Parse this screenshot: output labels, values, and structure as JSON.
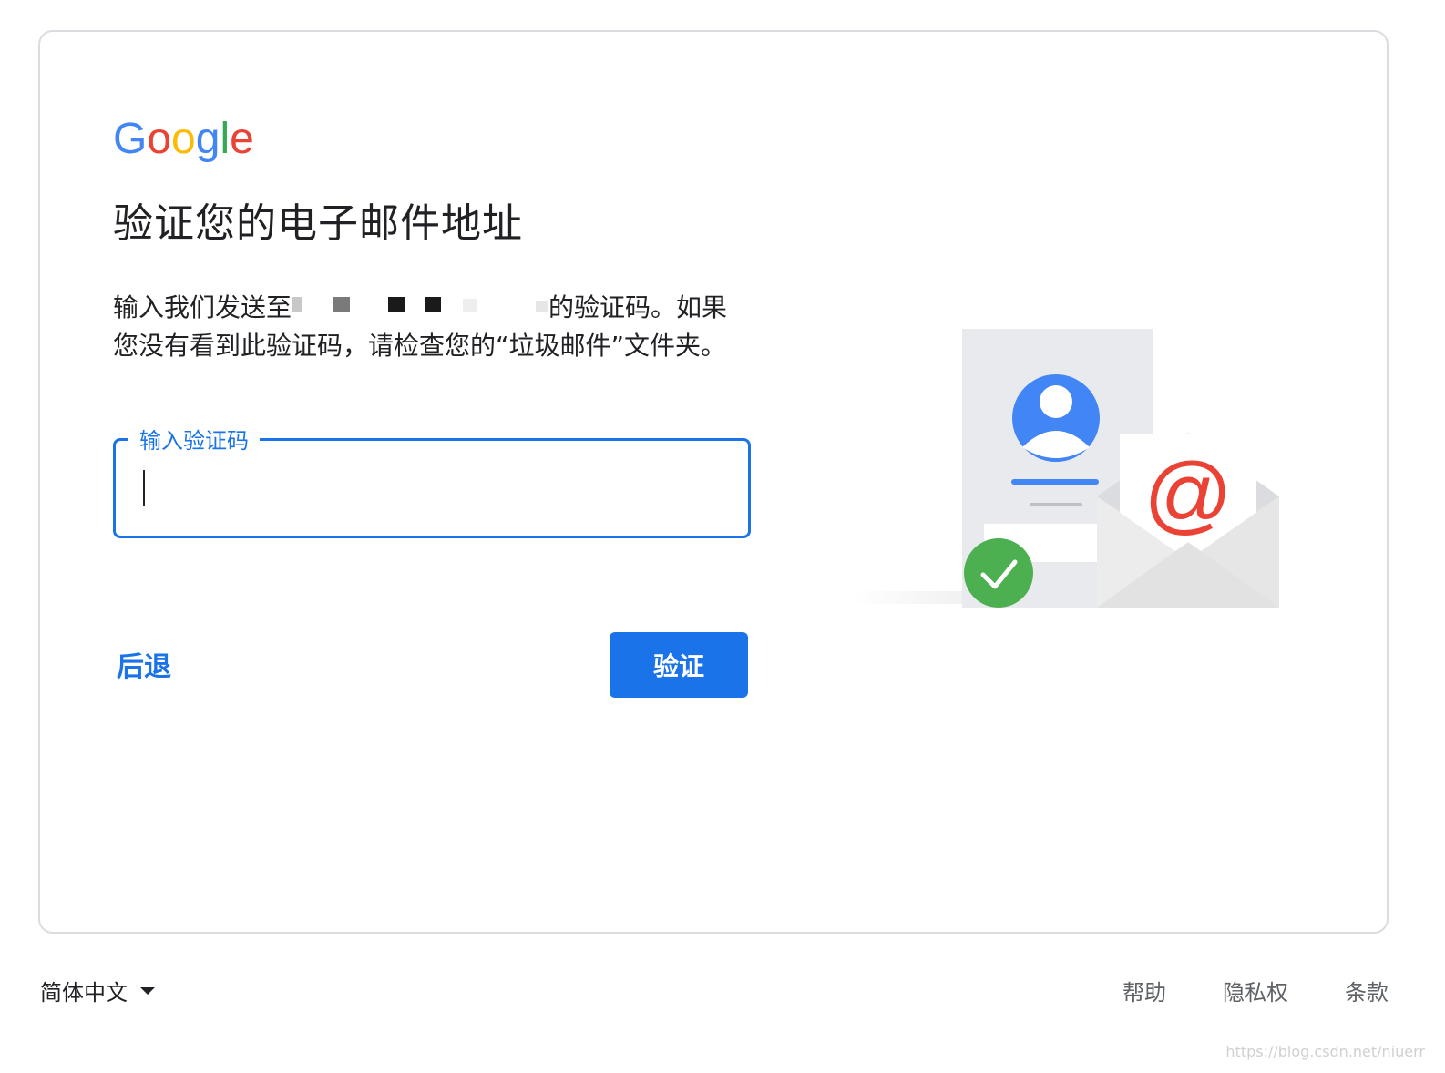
{
  "logo": {
    "text": "Google"
  },
  "page": {
    "title": "验证您的电子邮件地址",
    "desc_prefix": "输入我们发送至",
    "desc_suffix": "的验证码。如果您没有看到此验证码，请检查您的“垃圾邮件”文件夹。"
  },
  "code_field": {
    "label": "输入验证码",
    "value": ""
  },
  "actions": {
    "back": "后退",
    "verify": "验证"
  },
  "footer": {
    "language": "简体中文",
    "links": {
      "help": "帮助",
      "privacy": "隐私权",
      "terms": "条款"
    }
  },
  "watermark": "https://blog.csdn.net/niuerr",
  "colors": {
    "accent": "#1a73e8",
    "google_blue": "#4285f4",
    "google_red": "#ea4335",
    "google_yellow": "#fbbc05",
    "google_green": "#34a853",
    "check_green": "#4caf50"
  }
}
